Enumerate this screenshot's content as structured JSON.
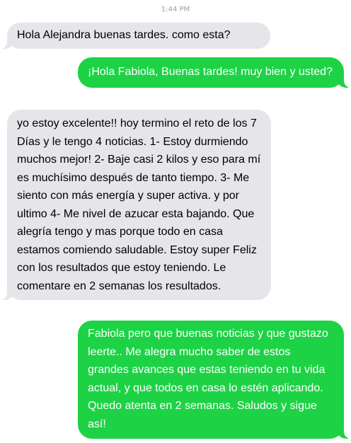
{
  "conversation": {
    "timestamp": "1:44 PM",
    "messages": [
      {
        "direction": "incoming",
        "text": "Hola Alejandra buenas tardes. como esta?"
      },
      {
        "direction": "outgoing",
        "text": "¡Hola Fabiola, Buenas tardes! muy bien y usted?"
      },
      {
        "direction": "incoming",
        "text": "yo estoy excelente!! hoy termino el reto de los 7 Días y le tengo 4 noticias. 1- Estoy durmiendo muchos mejor! 2- Baje casi 2 kilos y eso para mí es muchísimo después de tanto tiempo. 3- Me siento con más energía y super activa. y por ultimo 4- Me nivel de azucar esta bajando. Que alegría tengo y mas porque todo en casa estamos comiendo saludable. Estoy super Feliz con los resultados que estoy teniendo. Le comentare en 2 semanas los resultados."
      },
      {
        "direction": "outgoing",
        "text": "Fabiola pero que buenas noticias y que gustazo leerte.. Me alegra mucho saber de estos grandes avances que estas teniendo en tu vida actual, y que todos en casa lo estén aplicando. Quedo atenta en 2 semanas. Saludos y sigue así!"
      }
    ]
  },
  "colors": {
    "incoming_bubble": "#e5e5ea",
    "outgoing_bubble": "#1ed246",
    "timestamp_text": "#9e9ea3"
  }
}
